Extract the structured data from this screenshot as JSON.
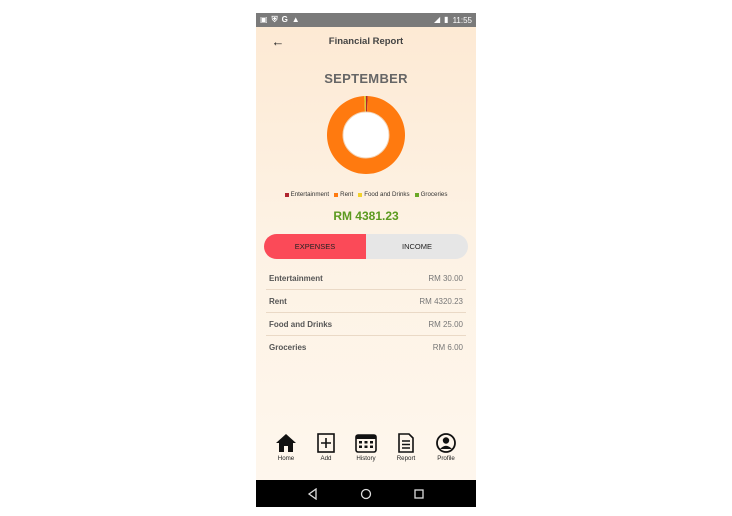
{
  "status_bar": {
    "left_icons": [
      "image-icon",
      "shield-icon",
      "google-icon",
      "warning-icon"
    ],
    "time": "11:55"
  },
  "header": {
    "title": "Financial Report"
  },
  "month": "SEPTEMBER",
  "chart_data": {
    "type": "pie",
    "categories": [
      "Entertainment",
      "Rent",
      "Food and Drinks",
      "Groceries"
    ],
    "values": [
      30.0,
      4320.23,
      25.0,
      6.0
    ],
    "colors": [
      "#b0262f",
      "#ff7a0f",
      "#f2d12c",
      "#6aa827"
    ],
    "donut": true
  },
  "legend": [
    {
      "label": "Entertainment",
      "color": "#b0262f"
    },
    {
      "label": "Rent",
      "color": "#ff7a0f"
    },
    {
      "label": "Food and Drinks",
      "color": "#f2d12c"
    },
    {
      "label": "Groceries",
      "color": "#6aa827"
    }
  ],
  "total": "RM 4381.23",
  "tabs": {
    "expenses": "EXPENSES",
    "income": "INCOME",
    "active": "expenses"
  },
  "items": [
    {
      "label": "Entertainment",
      "amount": "RM 30.00"
    },
    {
      "label": "Rent",
      "amount": "RM 4320.23"
    },
    {
      "label": "Food and Drinks",
      "amount": "RM 25.00"
    },
    {
      "label": "Groceries",
      "amount": "RM 6.00"
    }
  ],
  "nav": [
    {
      "label": "Home",
      "icon": "home-icon"
    },
    {
      "label": "Add",
      "icon": "add-icon"
    },
    {
      "label": "History",
      "icon": "calendar-icon"
    },
    {
      "label": "Report",
      "icon": "report-icon"
    },
    {
      "label": "Profile",
      "icon": "profile-icon"
    }
  ],
  "colors": {
    "accent_red": "#fb4a58",
    "total_green": "#5b9a1f"
  }
}
